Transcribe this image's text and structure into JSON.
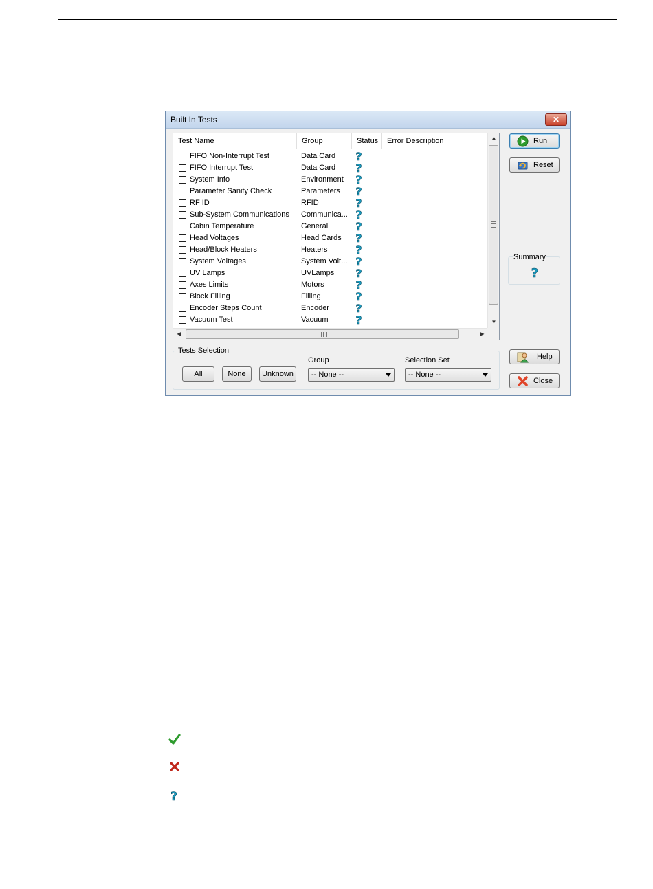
{
  "dialog": {
    "title": "Built In Tests",
    "close_label": "✕"
  },
  "columns": [
    "Test Name",
    "Group",
    "Status",
    "Error Description"
  ],
  "rows": [
    {
      "name": "FIFO Non-Interrupt Test",
      "group": "Data Card",
      "status": "unknown",
      "error": ""
    },
    {
      "name": "FIFO Interrupt Test",
      "group": "Data Card",
      "status": "unknown",
      "error": ""
    },
    {
      "name": "System Info",
      "group": "Environment",
      "status": "unknown",
      "error": ""
    },
    {
      "name": "Parameter Sanity Check",
      "group": "Parameters",
      "status": "unknown",
      "error": ""
    },
    {
      "name": "RF ID",
      "group": "RFID",
      "status": "unknown",
      "error": ""
    },
    {
      "name": "Sub-System Communications",
      "group": "Communica...",
      "status": "unknown",
      "error": ""
    },
    {
      "name": "Cabin Temperature",
      "group": "General",
      "status": "unknown",
      "error": ""
    },
    {
      "name": "Head Voltages",
      "group": "Head Cards",
      "status": "unknown",
      "error": ""
    },
    {
      "name": "Head/Block Heaters",
      "group": "Heaters",
      "status": "unknown",
      "error": ""
    },
    {
      "name": "System Voltages",
      "group": "System Volt...",
      "status": "unknown",
      "error": ""
    },
    {
      "name": "UV Lamps",
      "group": "UVLamps",
      "status": "unknown",
      "error": ""
    },
    {
      "name": "Axes Limits",
      "group": "Motors",
      "status": "unknown",
      "error": ""
    },
    {
      "name": "Block Filling",
      "group": "Filling",
      "status": "unknown",
      "error": ""
    },
    {
      "name": "Encoder Steps Count",
      "group": "Encoder",
      "status": "unknown",
      "error": ""
    },
    {
      "name": "Vacuum Test",
      "group": "Vacuum",
      "status": "unknown",
      "error": ""
    }
  ],
  "buttons": {
    "run": "Run",
    "reset": "Reset",
    "help": "Help",
    "close": "Close",
    "all": "All",
    "none": "None",
    "unknown": "Unknown"
  },
  "summary": {
    "label": "Summary",
    "icon": "question-icon"
  },
  "tests_selection": {
    "label": "Tests Selection",
    "group_label": "Group",
    "group_value": "-- None --",
    "set_label": "Selection Set",
    "set_value": "-- None --"
  },
  "legend_icons": [
    "check-icon",
    "cross-icon",
    "question-icon"
  ],
  "colors": {
    "pass": "#2e9b2e",
    "fail": "#c0281c",
    "unknown": "#1a9bbf"
  }
}
